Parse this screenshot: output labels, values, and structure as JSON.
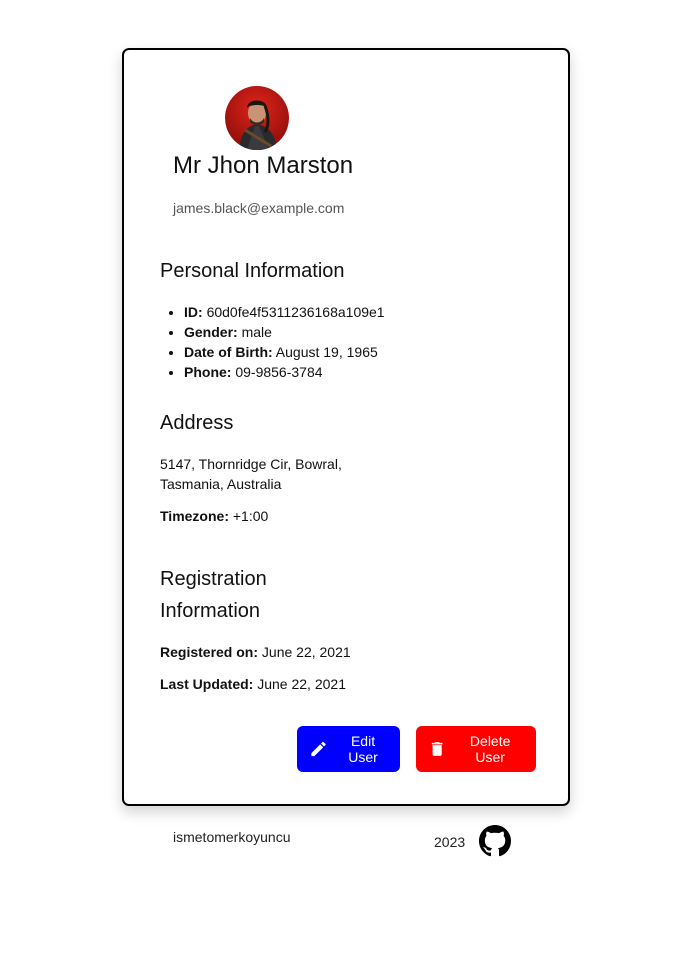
{
  "profile": {
    "name": "Mr Jhon Marston",
    "email": "james.black@example.com"
  },
  "personal": {
    "title": "Personal Information",
    "items": [
      {
        "label": "ID:",
        "value": "60d0fe4f5311236168a109e1"
      },
      {
        "label": "Gender:",
        "value": "male"
      },
      {
        "label": "Date of Birth:",
        "value": "August 19, 1965"
      },
      {
        "label": "Phone:",
        "value": "09-9856-3784"
      }
    ]
  },
  "address": {
    "title": "Address",
    "line1": "5147, Thornridge Cir, Bowral,",
    "line2": "Tasmania, Australia",
    "timezone_label": "Timezone:",
    "timezone_value": "+1:00"
  },
  "registration": {
    "title_line1": "Registration",
    "title_line2": "Information",
    "registered_label": "Registered on:",
    "registered_value": "June 22, 2021",
    "updated_label": "Last Updated:",
    "updated_value": "June 22, 2021"
  },
  "actions": {
    "edit_label": "Edit User",
    "edit_icon": "pencil-icon",
    "delete_label": "Delete User",
    "delete_icon": "trash-icon"
  },
  "footer": {
    "username": "ismetomerkoyuncu",
    "year": "2023",
    "icon": "github-icon"
  },
  "colors": {
    "edit": "#0000ff",
    "delete": "#ff0000"
  }
}
